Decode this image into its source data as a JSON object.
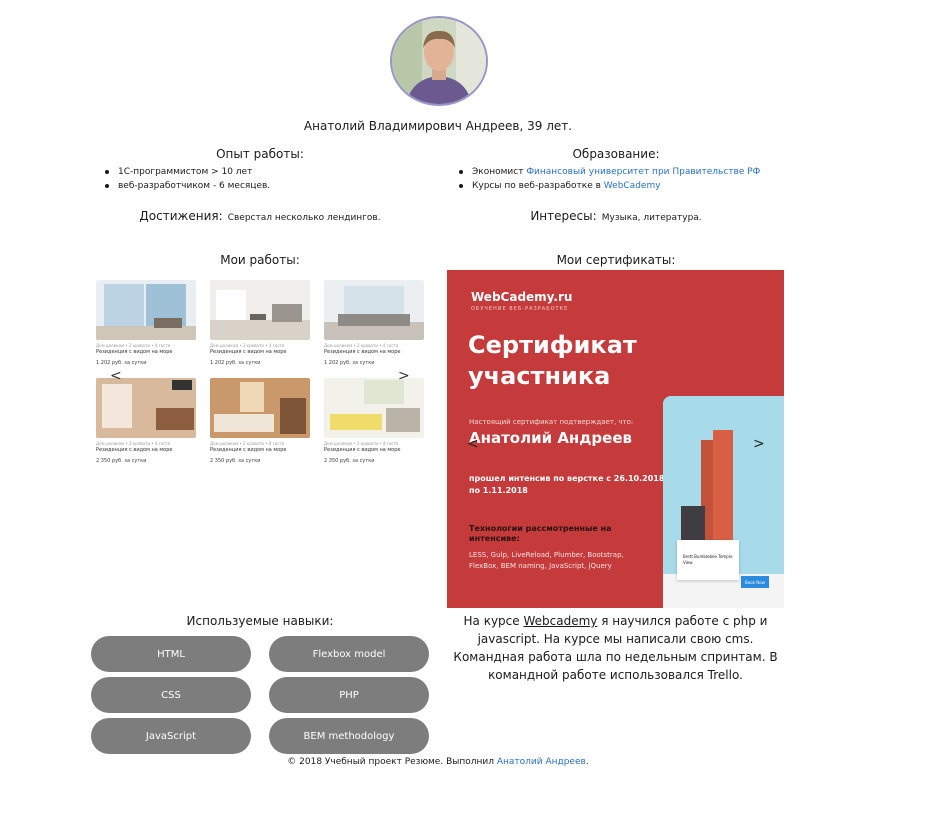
{
  "header": {
    "name_age": "Анатолий Владимирович Андреев, 39 лет."
  },
  "experience": {
    "title": "Опыт работы:",
    "items": [
      "1С-программистом > 10 лет",
      "веб-разработчиком - 6 месяцев."
    ]
  },
  "education": {
    "title": "Образование:",
    "items": [
      {
        "prefix": "Экономист ",
        "link": "Финансовый университет при Правительстве РФ"
      },
      {
        "prefix": "Курсы по веб-разработке в ",
        "link": "WebCademy"
      }
    ]
  },
  "achievements": {
    "label": "Достижения:",
    "text": "Сверстал несколько лендингов."
  },
  "interests": {
    "label": "Интересы:",
    "text": "Музыка, литература."
  },
  "works": {
    "title": "Мои работы:",
    "cards": [
      {
        "meta": "Дом целиком • 2 кровати • 4 гостя",
        "title": "Резиденция с видом на море",
        "price": "1 202 руб. за сутки"
      },
      {
        "meta": "Дом целиком • 2 кровати • 4 гостя",
        "title": "Резиденция с видом на море",
        "price": "1 202 руб. за сутки"
      },
      {
        "meta": "Дом целиком • 2 кровати • 4 гостя",
        "title": "Резиденция с видом на море",
        "price": "1 202 руб. за сутки"
      },
      {
        "meta": "Дом целиком • 2 кровати • 4 гостя",
        "title": "Резиденция с видом на море",
        "price": "2 350 руб. за сутки"
      },
      {
        "meta": "Дом целиком • 2 кровати • 4 гостя",
        "title": "Резиденция с видом на море",
        "price": "2 350 руб. за сутки"
      },
      {
        "meta": "Дом целиком • 2 кровати • 4 гостя",
        "title": "Резиденция с видом на море",
        "price": "2 350 руб. за сутки"
      }
    ],
    "prev": "<",
    "next": ">"
  },
  "certificates": {
    "title": "Мои сертификаты:",
    "brand": "WebCademy.ru",
    "brand_sub": "ОБУЧЕНИЕ ВЕБ-РАЗРАБОТКЕ",
    "heading_line1": "Сертификат",
    "heading_line2": "участника",
    "confirm": "Настоящий сертификат подтверждает, что:",
    "person": "Анатолий Андреев",
    "passed": "прошел интенсив по верстке с 26.10.2018 по 1.11.2018",
    "tech_heading": "Технологии рассмотренные на интенсиве:",
    "tech_list": "LESS, Gulp, LiveReload, Plumber, Bootstrap, FlexBox, BEM naming, JavaScript, jQuery",
    "phone_card_title": "Brett Bumblebee Temple View",
    "phone_button": "Book Now",
    "prev": "<",
    "next": ">"
  },
  "skills": {
    "title": "Используемые навыки:",
    "items": [
      "HTML",
      "Flexbox model",
      "CSS",
      "PHP",
      "JavaScript",
      "BEM methodology"
    ]
  },
  "about": {
    "before": "На курсе ",
    "link": "Webcademy",
    "after": " я научился работе с php и javascript. На курсе мы написали свою cms. Командная работа шла по недельным спринтам. В командной работе использовался Trello."
  },
  "footer": {
    "text": "© 2018 Учебный проект Резюме. Выполнил ",
    "link": "Анатолий Андреев",
    "end": "."
  },
  "colors": {
    "link": "#2a72c4",
    "certificate_bg": "#c53a3a",
    "skill_button": "#7d7d7d",
    "avatar_border": "#9a95c9"
  }
}
